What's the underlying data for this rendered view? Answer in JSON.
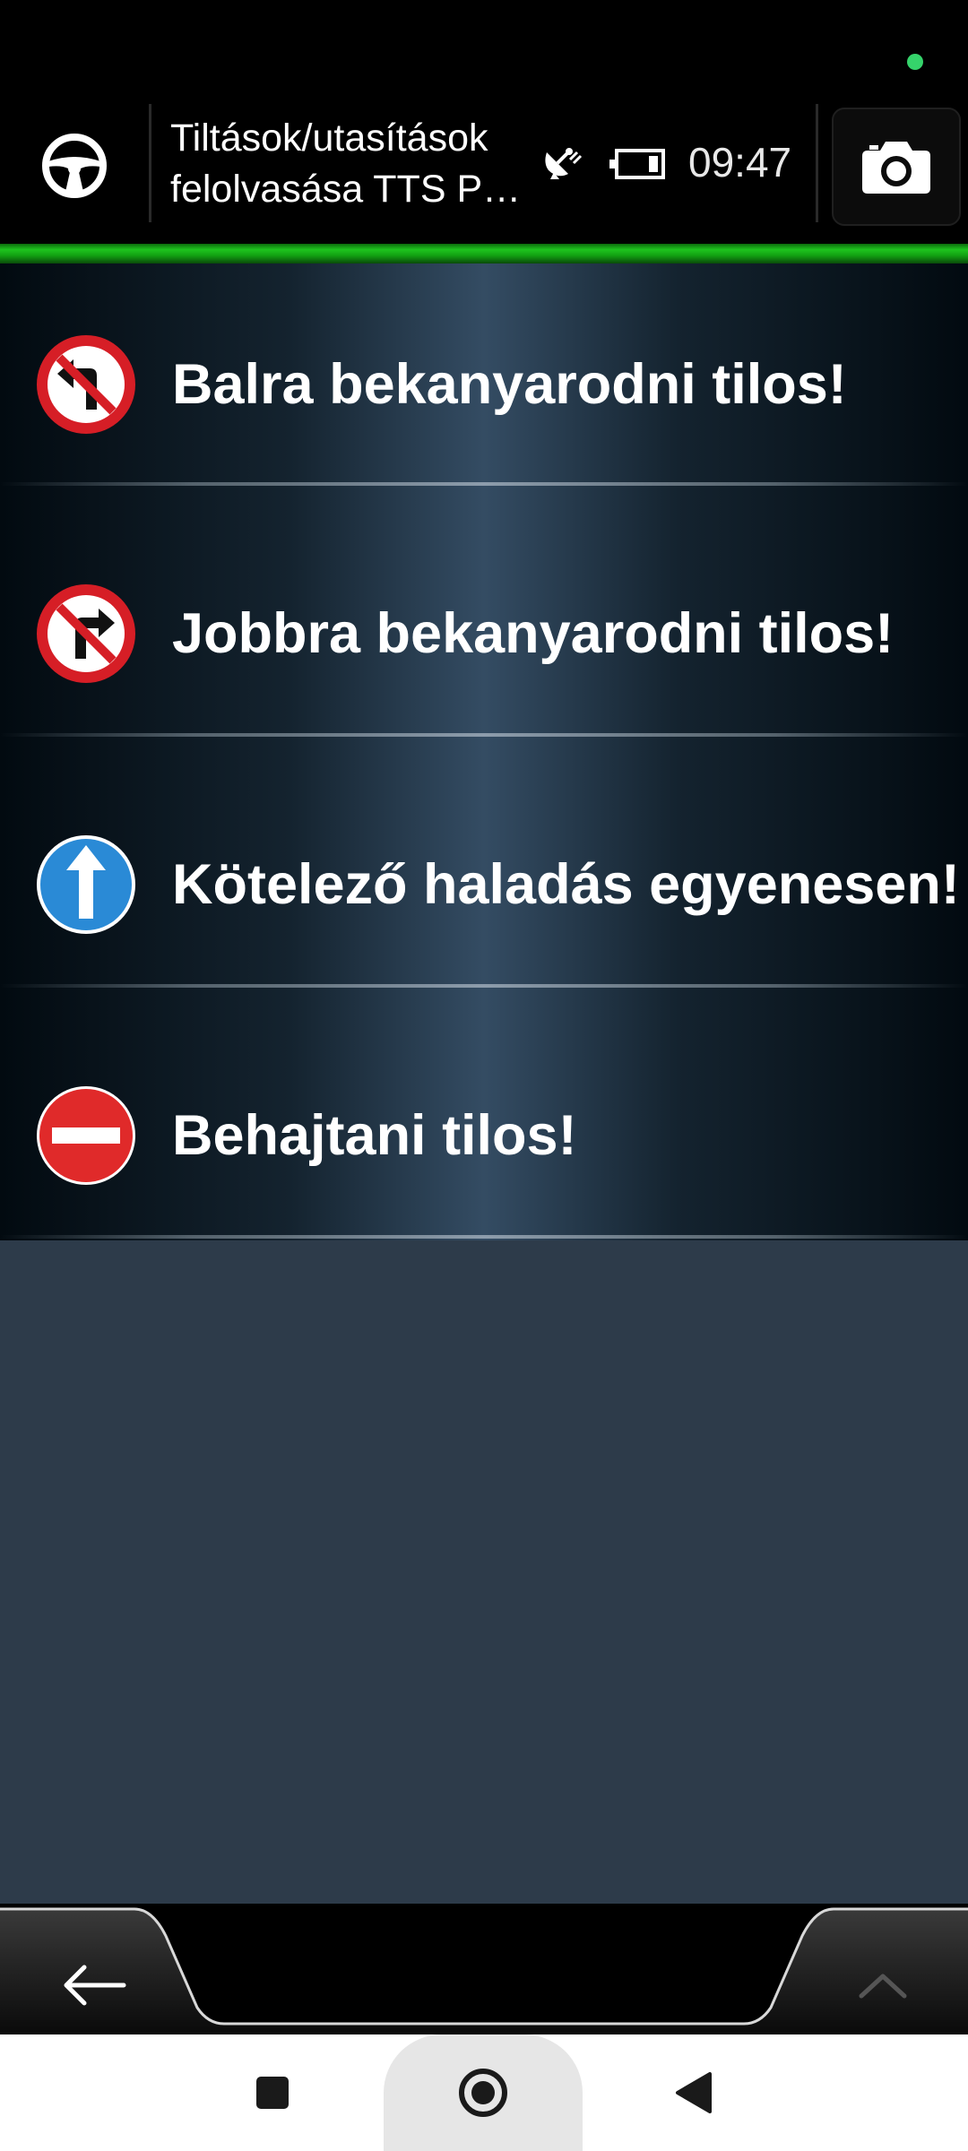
{
  "header": {
    "title_line1": "Tiltások/utasítások",
    "title_line2": "felolvasása TTS Pro...",
    "clock": "09:47",
    "icons": {
      "left": "steering-wheel-icon",
      "gps": "satellite-dish-icon",
      "battery": "battery-icon",
      "right": "camera-icon"
    },
    "colors": {
      "accent_green": "#1ec41e",
      "status_dot": "#35d36b"
    }
  },
  "list": {
    "items": [
      {
        "label": "Balra bekanyarodni tilos!",
        "icon": "no-left-turn-sign-icon"
      },
      {
        "label": "Jobbra bekanyarodni tilos!",
        "icon": "no-right-turn-sign-icon"
      },
      {
        "label": "Kötelező haladás egyenesen!",
        "icon": "straight-ahead-only-sign-icon"
      },
      {
        "label": "Behajtani tilos!",
        "icon": "no-entry-sign-icon"
      }
    ]
  },
  "toolbar": {
    "back_icon": "arrow-left-icon",
    "up_icon": "chevron-up-icon"
  },
  "system_nav": {
    "recents_icon": "square-icon",
    "home_icon": "circle-icon",
    "back_icon": "triangle-back-icon"
  }
}
